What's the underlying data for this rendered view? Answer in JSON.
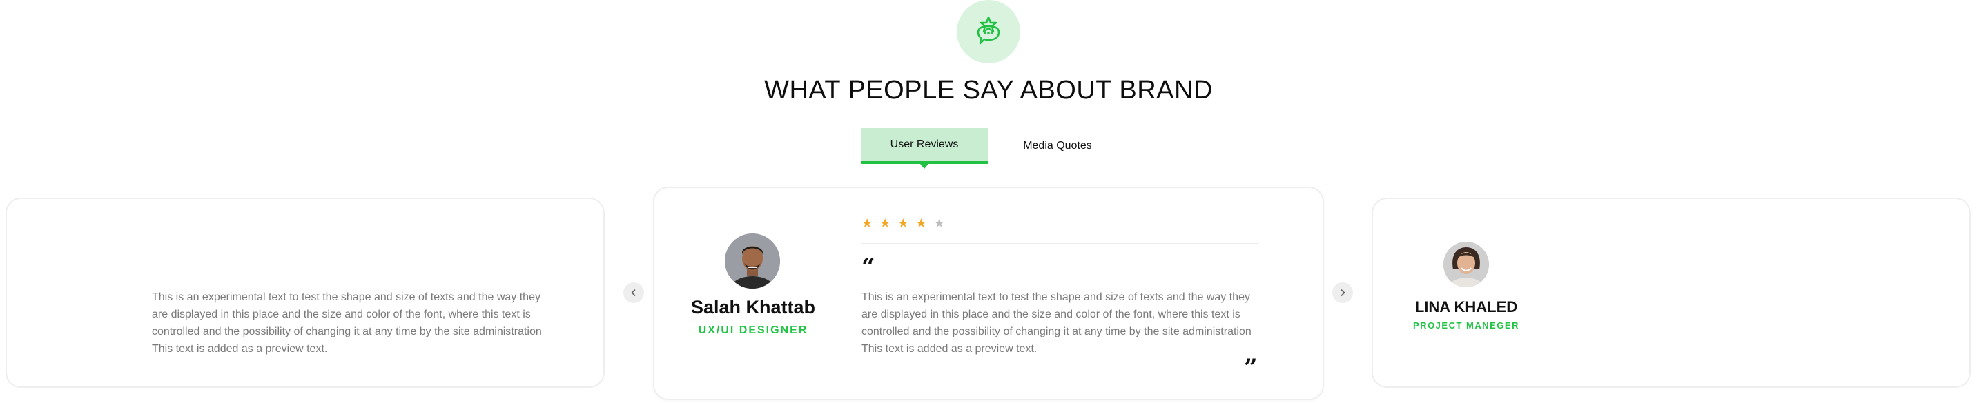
{
  "section": {
    "title": "WHAT PEOPLE SAY ABOUT BRAND",
    "icon": "chat-star-icon",
    "accent": "#22c143",
    "accent_light": "#d9f3de"
  },
  "tabs": [
    {
      "label": "User Reviews",
      "active": true
    },
    {
      "label": "Media Quotes",
      "active": false
    }
  ],
  "carousel": {
    "prev_icon": "chevron-left-icon",
    "next_icon": "chevron-right-icon",
    "reviews": [
      {
        "position": "left",
        "text": "This is an experimental text to test the shape and size of texts and the way they are displayed in this place and the size and color of the font, where this text is controlled and the possibility of changing it at any time by the site administration This text is added as a preview text."
      },
      {
        "position": "center",
        "name": "Salah Khattab",
        "role": "UX/UI DESIGNER",
        "rating": 4,
        "rating_max": 5,
        "open_quote": "“",
        "close_quote": "”",
        "text": "This is an experimental text to test the shape and size of texts and the way they are displayed in this place and the size and color of the font, where this text is controlled and the possibility of changing it at any time by the site administration This text is added as a preview text."
      },
      {
        "position": "right",
        "name": "LINA KHALED",
        "role": "PROJECT MANEGER"
      }
    ]
  }
}
